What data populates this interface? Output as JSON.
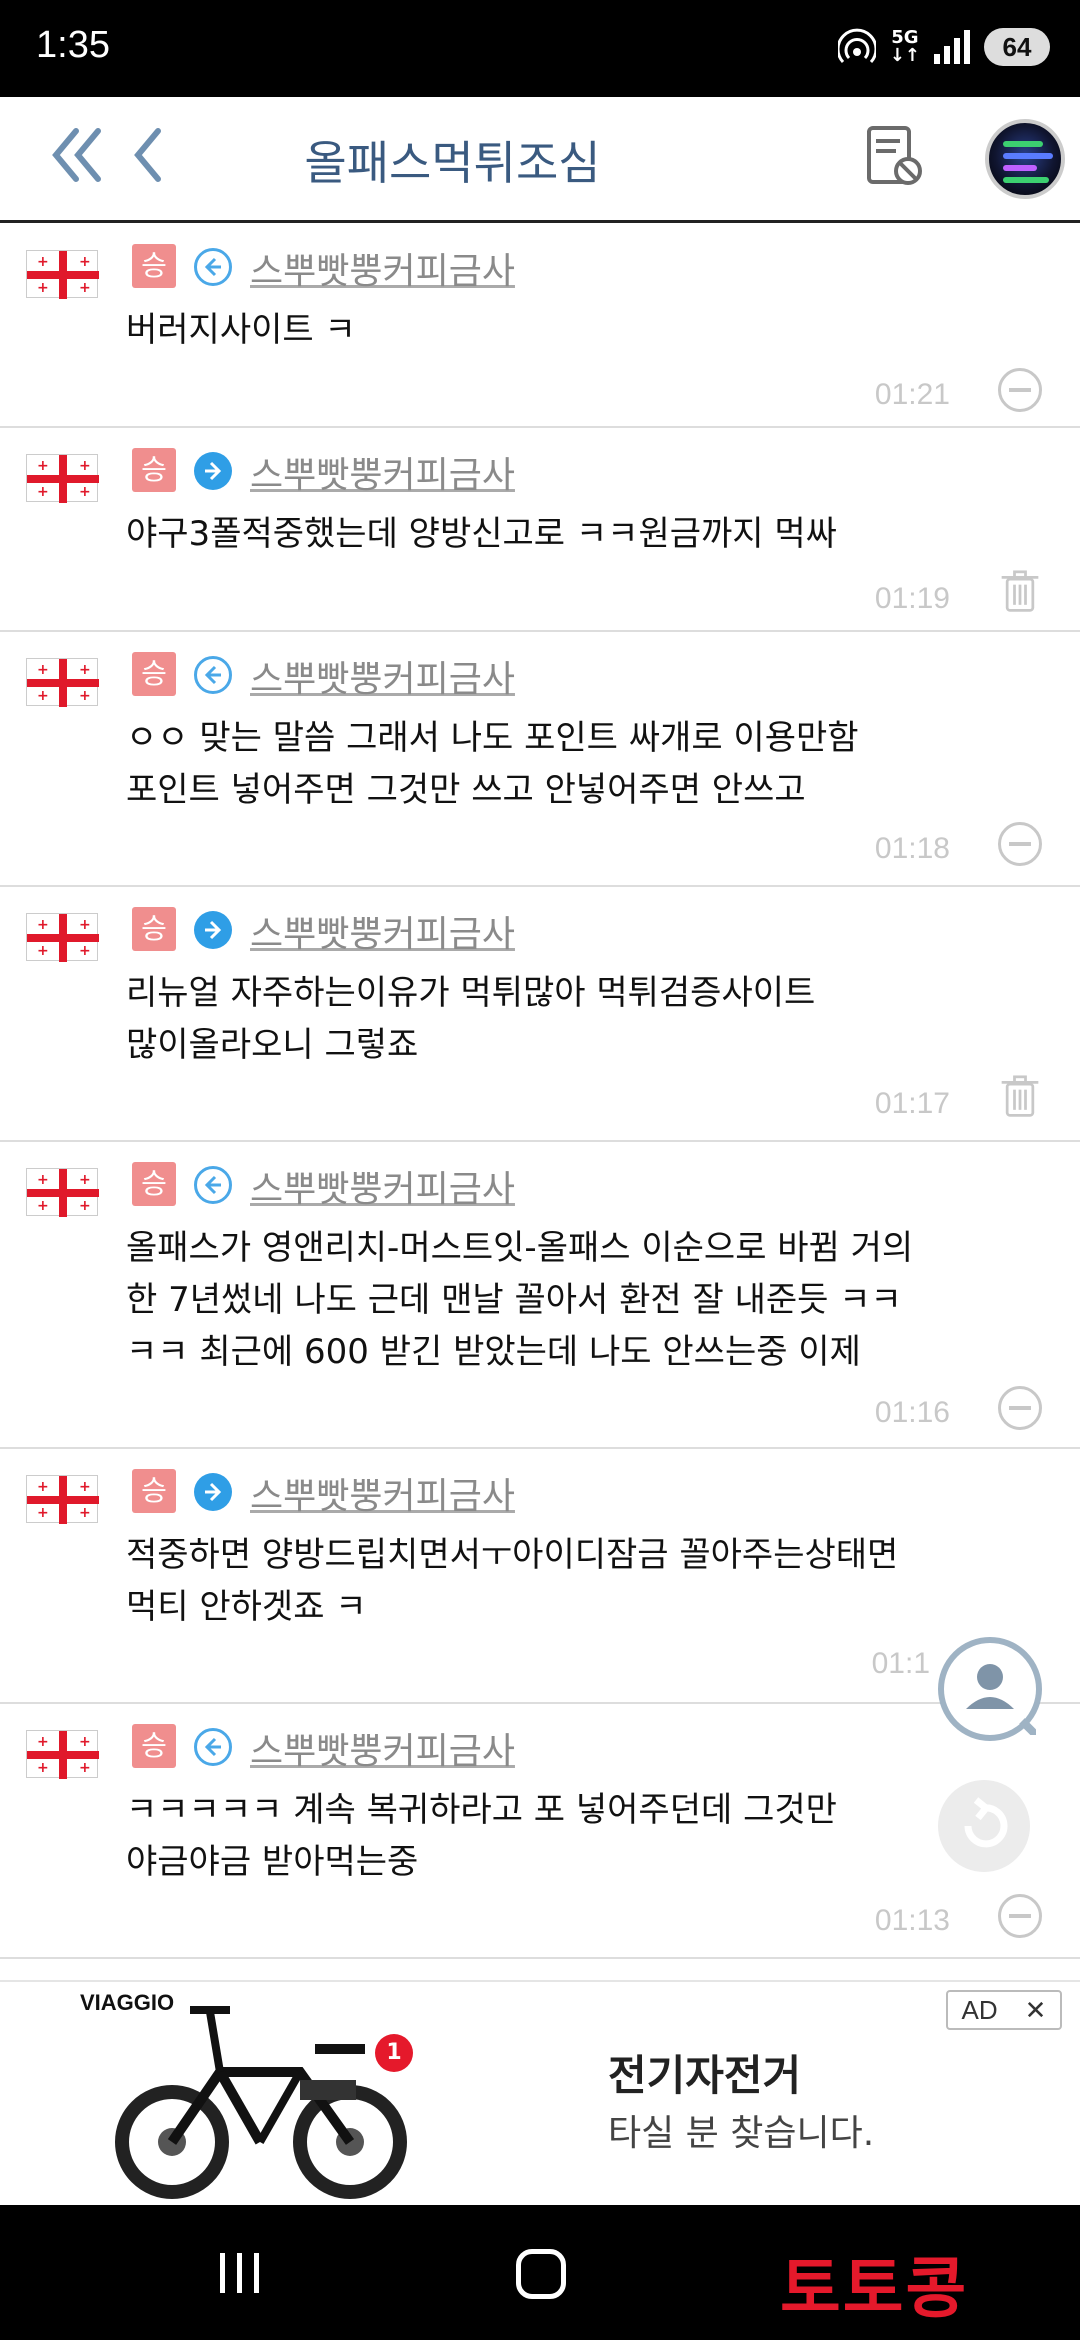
{
  "status_bar": {
    "time": "1:35",
    "network": "5G",
    "battery": "64"
  },
  "header": {
    "title": "올패스먹튀조심"
  },
  "posts": [
    {
      "badge": "승",
      "direction": "left",
      "author": "스뿌빳뿡커피금사",
      "text": "버러지사이트 ㅋ",
      "time": "01:21",
      "action": "minus"
    },
    {
      "badge": "승",
      "direction": "right",
      "author": "스뿌빳뿡커피금사",
      "text": "야구3폴적중했는데 양방신고로 ㅋㅋ원금까지 먹싸",
      "time": "01:19",
      "action": "trash"
    },
    {
      "badge": "승",
      "direction": "left",
      "author": "스뿌빳뿡커피금사",
      "text": "ㅇㅇ 맞는 말씀 그래서 나도 포인트 싸개로 이용만함\n포인트 넣어주면 그것만 쓰고 안넣어주면 안쓰고",
      "time": "01:18",
      "action": "minus"
    },
    {
      "badge": "승",
      "direction": "right",
      "author": "스뿌빳뿡커피금사",
      "text": "리뉴얼 자주하는이유가 먹튀많아 먹튀검증사이트\n많이올라오니 그렇죠",
      "time": "01:17",
      "action": "trash"
    },
    {
      "badge": "승",
      "direction": "left",
      "author": "스뿌빳뿡커피금사",
      "text": "올패스가 영앤리치-머스트잇-올패스 이순으로 바뀜 거의\n한 7년썼네 나도 근데 맨날 꼴아서 환전 잘 내준듯 ㅋㅋ\nㅋㅋ 최근에 600 받긴 받았는데 나도 안쓰는중 이제",
      "time": "01:16",
      "action": "minus"
    },
    {
      "badge": "승",
      "direction": "right",
      "author": "스뿌빳뿡커피금사",
      "text": "적중하면 양방드립치면서ㅜ아이디잠금  꼴아주는상태면\n먹티 안하겟죠 ㅋ",
      "time": "01:1",
      "action": "none"
    },
    {
      "badge": "승",
      "direction": "left",
      "author": "스뿌빳뿡커피금사",
      "text": "ㅋㅋㅋㅋㅋ 계속 복귀하라고 포 넣어주던데 그것만\n야금야금 받아먹는중",
      "time": "01:13",
      "action": "minus"
    }
  ],
  "ad": {
    "brand": "VIAGGIO",
    "notification_count": "1",
    "headline": "전기자전거",
    "subtitle": "타실 분 찾습니다.",
    "ad_label": "AD",
    "close": "✕"
  },
  "watermark": "토토콩"
}
